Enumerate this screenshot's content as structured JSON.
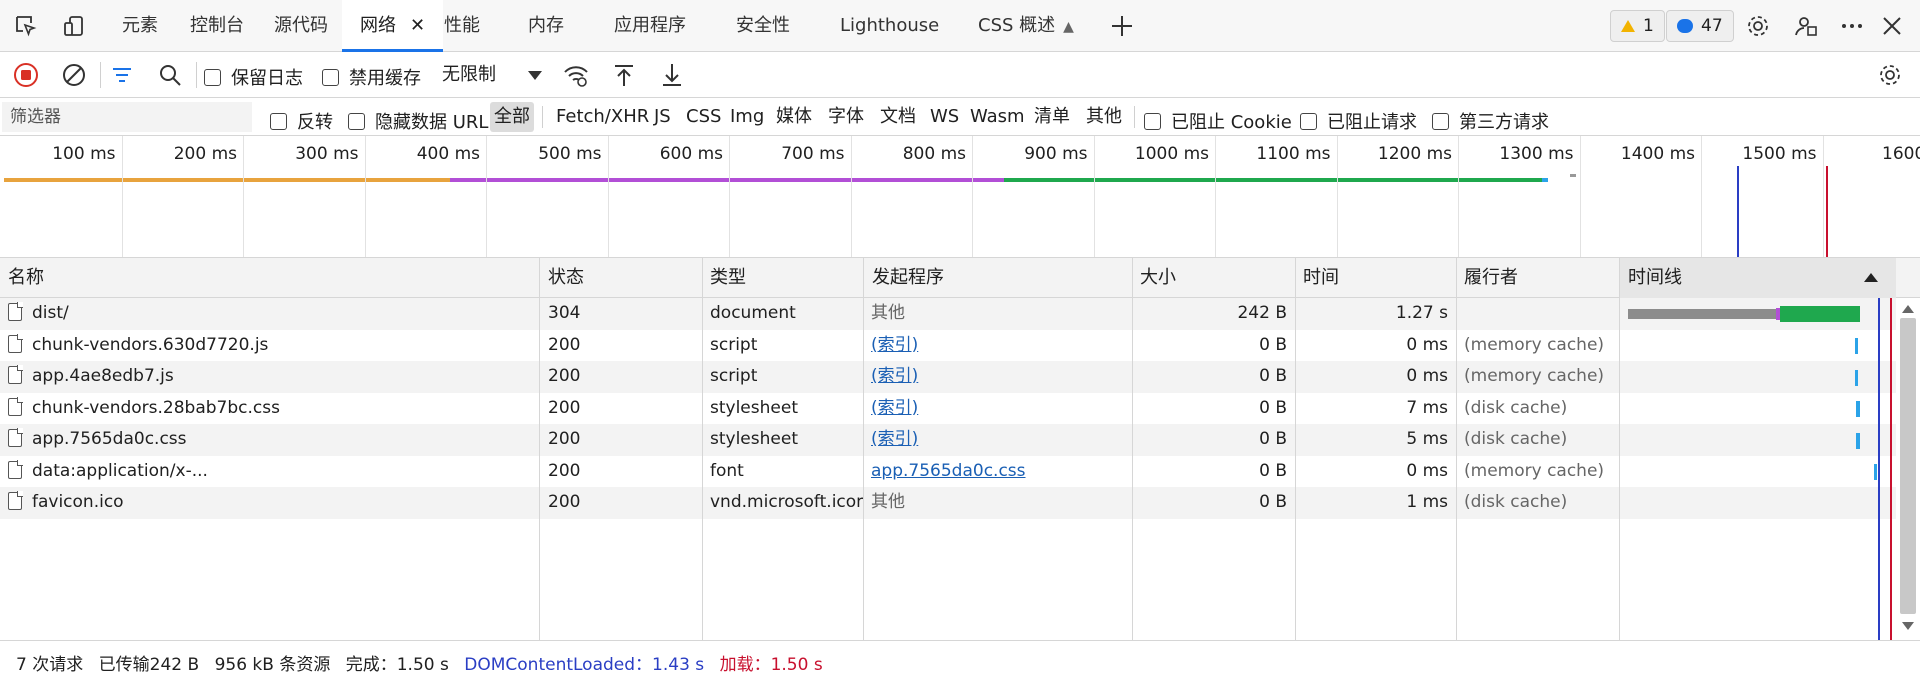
{
  "tabs": [
    {
      "label": "元素"
    },
    {
      "label": "控制台"
    },
    {
      "label": "源代码"
    },
    {
      "label": "网络",
      "active": true
    },
    {
      "label": "性能"
    },
    {
      "label": "内存"
    },
    {
      "label": "应用程序"
    },
    {
      "label": "安全性"
    },
    {
      "label": "Lighthouse"
    },
    {
      "label": "CSS 概述"
    }
  ],
  "badges": {
    "warnings": "1",
    "messages": "47"
  },
  "toolbar": {
    "preserve_log": "保留日志",
    "disable_cache": "禁用缓存",
    "throttle": "无限制"
  },
  "filter": {
    "placeholder": "筛选器",
    "invert": "反转",
    "hide_data_urls": "隐藏数据 URL",
    "types": [
      "全部",
      "Fetch/XHR",
      "JS",
      "CSS",
      "Img",
      "媒体",
      "字体",
      "文档",
      "WS",
      "Wasm",
      "清单",
      "其他"
    ],
    "blocked_cookies": "已阻止 Cookie",
    "blocked_requests": "已阻止请求",
    "third_party": "第三方请求"
  },
  "overview": {
    "ticks": [
      "100 ms",
      "200 ms",
      "300 ms",
      "400 ms",
      "500 ms",
      "600 ms",
      "700 ms",
      "800 ms",
      "900 ms",
      "1000 ms",
      "1100 ms",
      "1200 ms",
      "1300 ms",
      "1400 ms",
      "1500 ms",
      "1600"
    ],
    "colors": {
      "stalled": "#e8a33d",
      "waiting": "#b24fd6",
      "download": "#1fa84e",
      "dcl": "#2a3ec4",
      "load": "#c8102e"
    }
  },
  "columns": [
    "名称",
    "状态",
    "类型",
    "发起程序",
    "大小",
    "时间",
    "履行者",
    "时间线"
  ],
  "rows": [
    {
      "name": "dist/",
      "status": "304",
      "type": "document",
      "initiator": "其他",
      "initiator_link": false,
      "size": "242 B",
      "time": "1.27 s",
      "fulfilled": ""
    },
    {
      "name": "chunk-vendors.630d7720.js",
      "status": "200",
      "type": "script",
      "initiator": "(索引)",
      "initiator_link": true,
      "size": "0 B",
      "time": "0 ms",
      "fulfilled": "(memory cache)"
    },
    {
      "name": "app.4ae8edb7.js",
      "status": "200",
      "type": "script",
      "initiator": "(索引)",
      "initiator_link": true,
      "size": "0 B",
      "time": "0 ms",
      "fulfilled": "(memory cache)"
    },
    {
      "name": "chunk-vendors.28bab7bc.css",
      "status": "200",
      "type": "stylesheet",
      "initiator": "(索引)",
      "initiator_link": true,
      "size": "0 B",
      "time": "7 ms",
      "fulfilled": "(disk cache)"
    },
    {
      "name": "app.7565da0c.css",
      "status": "200",
      "type": "stylesheet",
      "initiator": "(索引)",
      "initiator_link": true,
      "size": "0 B",
      "time": "5 ms",
      "fulfilled": "(disk cache)"
    },
    {
      "name": "data:application/x-...",
      "status": "200",
      "type": "font",
      "initiator": "app.7565da0c.css",
      "initiator_link": true,
      "size": "0 B",
      "time": "0 ms",
      "fulfilled": "(memory cache)"
    },
    {
      "name": "favicon.ico",
      "status": "200",
      "type": "vnd.microsoft.icon",
      "initiator": "其他",
      "initiator_link": false,
      "size": "0 B",
      "time": "1 ms",
      "fulfilled": "(disk cache)"
    }
  ],
  "status": {
    "requests": "7 次请求",
    "transferred": "已传输242 B",
    "resources": "956 kB 条资源",
    "finish": "完成：1.50 s",
    "dcl": "DOMContentLoaded：1.43 s",
    "load": "加载：1.50 s"
  }
}
